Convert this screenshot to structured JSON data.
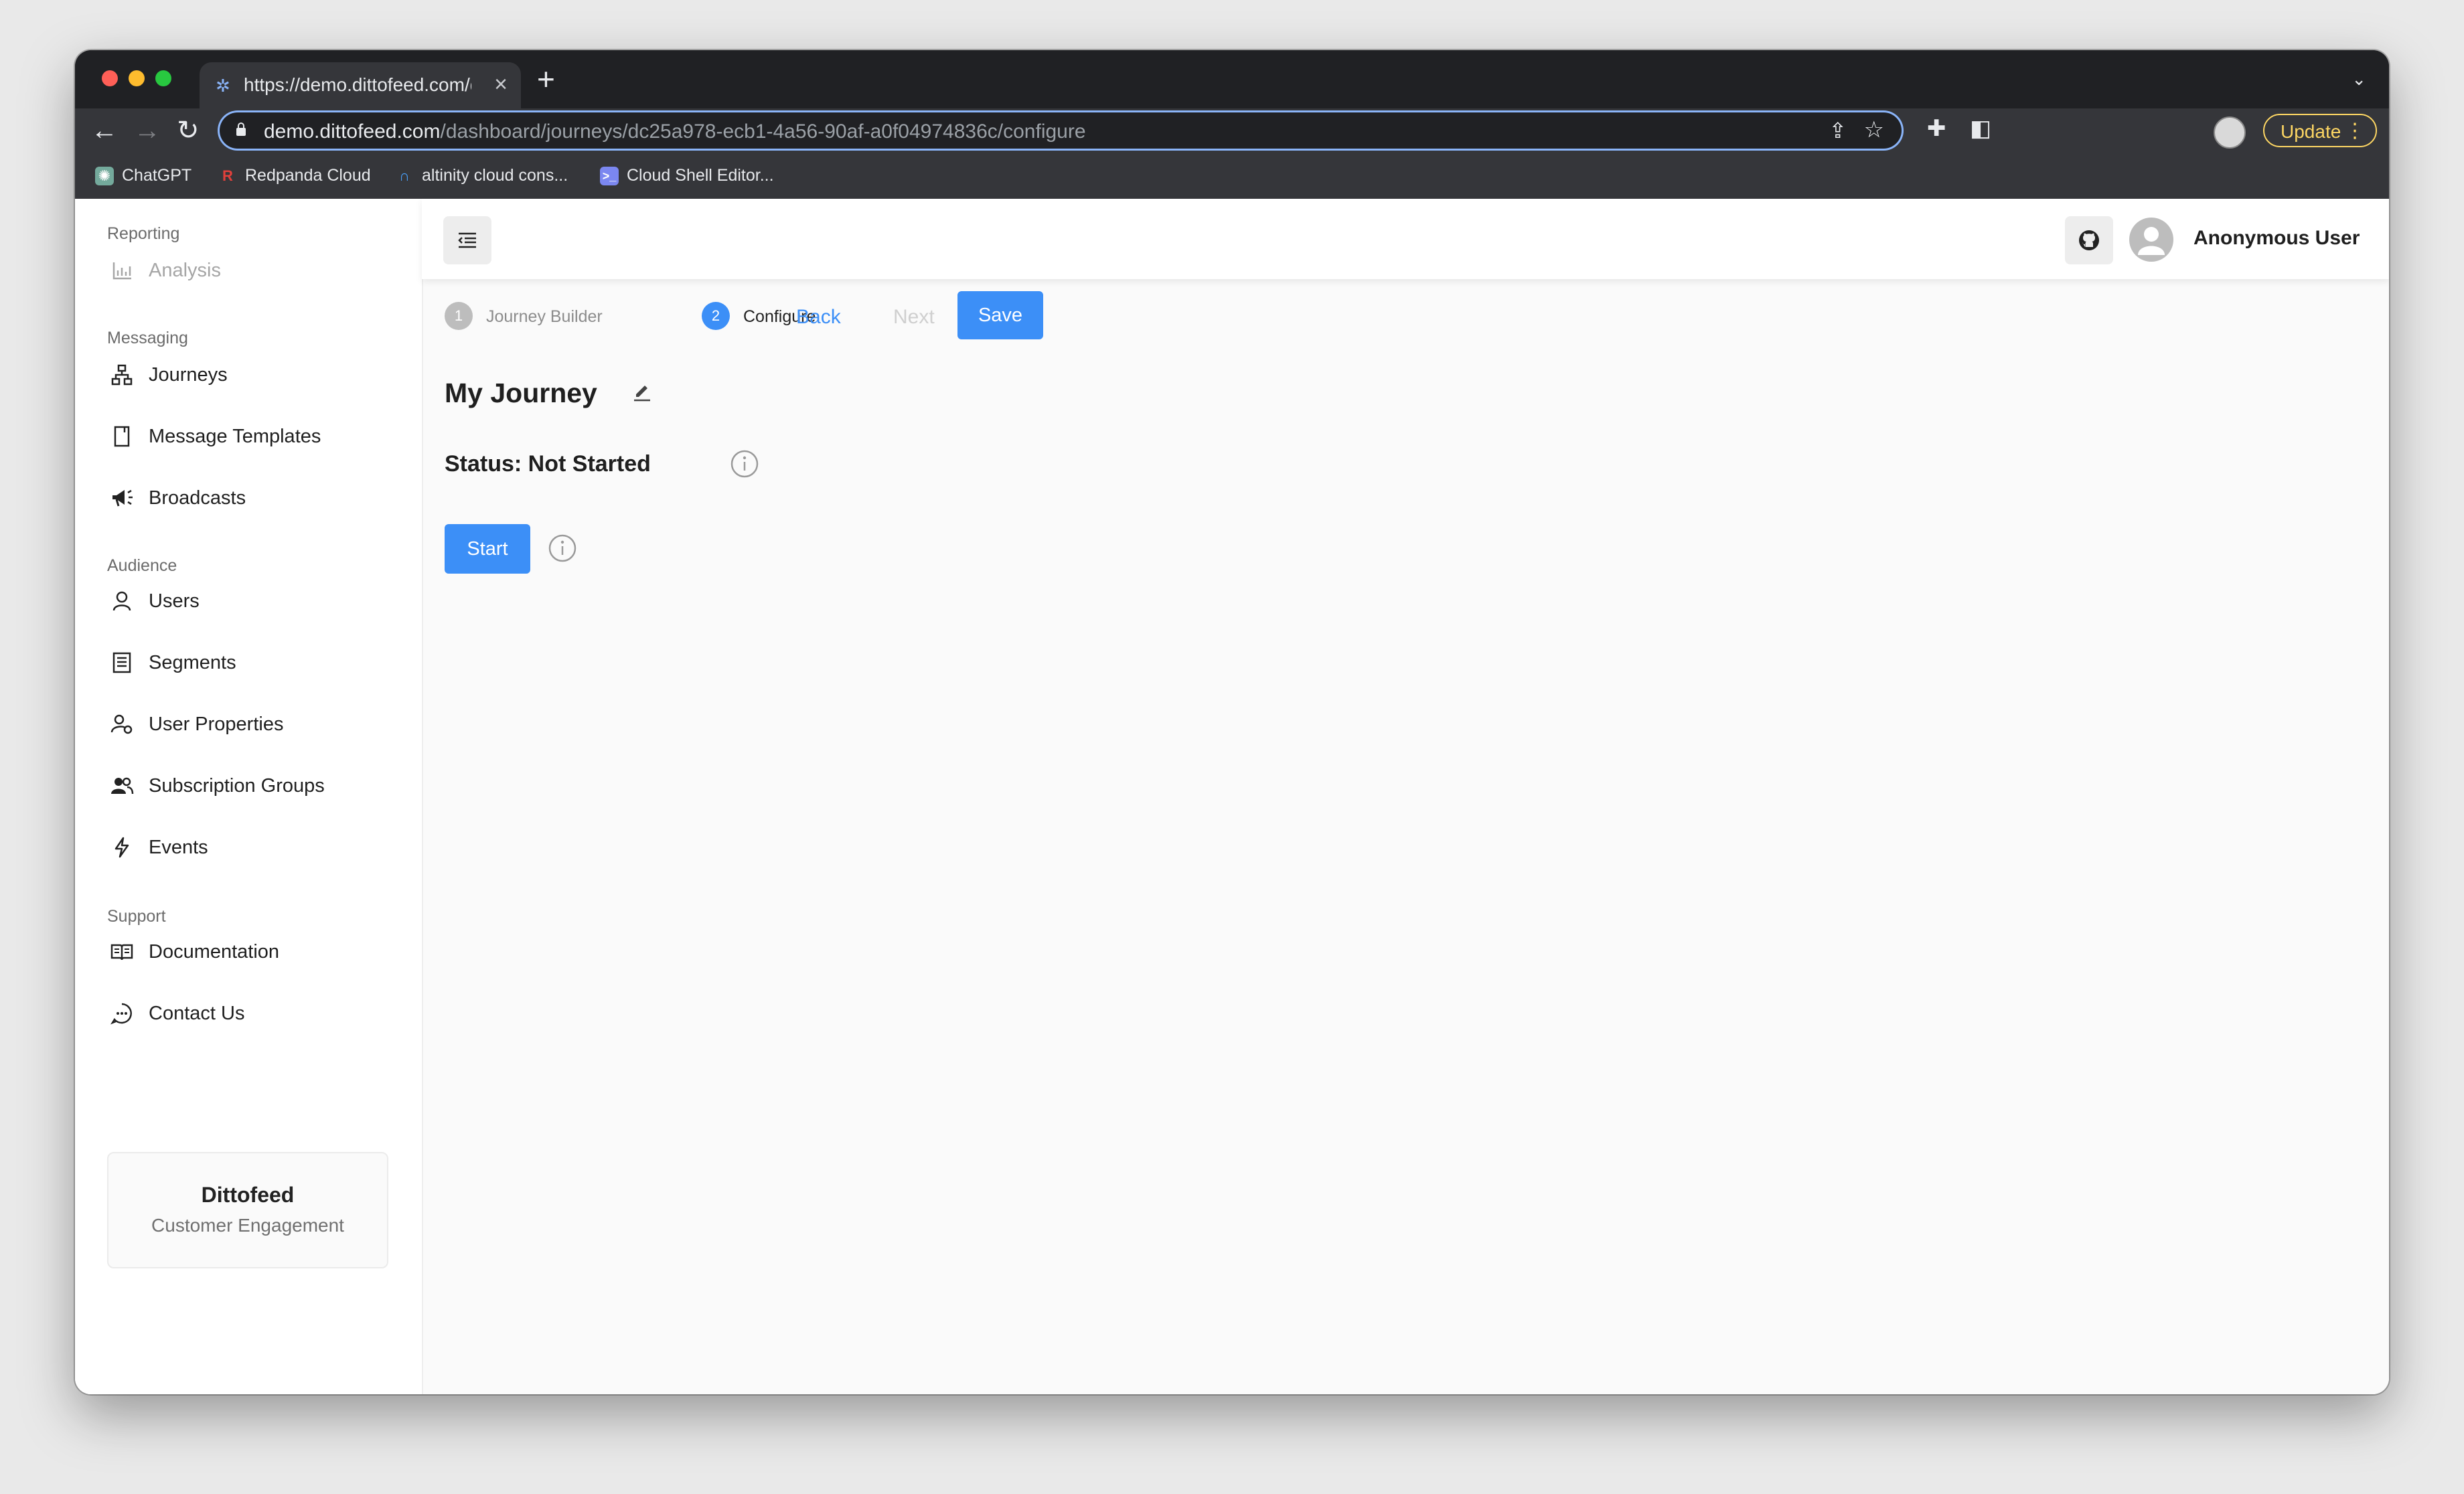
{
  "browser": {
    "tab_title": "https://demo.dittofeed.com/da",
    "tab_close": "×",
    "new_tab": "+",
    "url_host": "demo.dittofeed.com",
    "url_path": "/dashboard/journeys/dc25a978-ecb1-4a56-90af-a0f04974836c/configure",
    "update_label": "Update",
    "bookmarks": [
      {
        "label": "ChatGPT"
      },
      {
        "label": "Redpanda Cloud"
      },
      {
        "label": "altinity cloud cons..."
      },
      {
        "label": "Cloud Shell Editor..."
      }
    ]
  },
  "sidebar": {
    "sections": {
      "reporting": "Reporting",
      "messaging": "Messaging",
      "audience": "Audience",
      "support": "Support"
    },
    "items": {
      "analysis": "Analysis",
      "journeys": "Journeys",
      "message_templates": "Message Templates",
      "broadcasts": "Broadcasts",
      "users": "Users",
      "segments": "Segments",
      "user_properties": "User Properties",
      "subscription_groups": "Subscription Groups",
      "events": "Events",
      "documentation": "Documentation",
      "contact_us": "Contact Us"
    },
    "brand": {
      "name": "Dittofeed",
      "tagline": "Customer Engagement"
    }
  },
  "header": {
    "username": "Anonymous User"
  },
  "stepper": {
    "steps": [
      {
        "number": "1",
        "label": "Journey Builder",
        "active": false
      },
      {
        "number": "2",
        "label": "Configure",
        "active": true
      }
    ],
    "back_label": "Back",
    "next_label": "Next",
    "save_label": "Save"
  },
  "journey": {
    "name": "My Journey",
    "status": "Status: Not Started",
    "start_label": "Start"
  },
  "colors": {
    "primary": "#3c8ff7",
    "chrome_bg": "#202124",
    "update_yellow": "#fdd663"
  }
}
